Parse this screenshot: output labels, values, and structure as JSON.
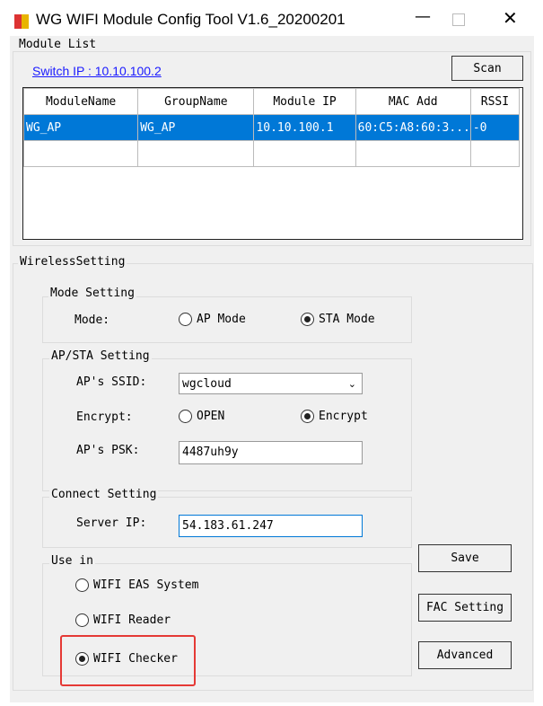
{
  "window": {
    "title": "WG WIFI Module Config Tool V1.6_20200201"
  },
  "module_list": {
    "label": "Module List",
    "switch_ip": "Switch IP : 10.10.100.2",
    "scan": "Scan",
    "columns": [
      "ModuleName",
      "GroupName",
      "Module IP",
      "MAC Add",
      "RSSI"
    ],
    "rows": [
      [
        "WG_AP",
        "WG_AP",
        "10.10.100.1",
        "60:C5:A8:60:3...",
        "-0"
      ]
    ]
  },
  "wireless": {
    "label": "WirelessSetting",
    "mode": {
      "label": "Mode Setting",
      "field": "Mode:",
      "ap": "AP Mode",
      "sta": "STA Mode",
      "selected": "STA Mode"
    },
    "apsta": {
      "label": "AP/STA Setting",
      "ssid_label": "AP's SSID:",
      "ssid": "wgcloud",
      "encrypt_label": "Encrypt:",
      "open": "OPEN",
      "encrypt": "Encrypt",
      "selected": "Encrypt",
      "psk_label": "AP's PSK:",
      "psk": "4487uh9y"
    },
    "connect": {
      "label": "Connect Setting",
      "server_label": "Server IP:",
      "server_ip": "54.183.61.247"
    },
    "use_in": {
      "label": "Use in",
      "options": [
        "WIFI EAS System",
        "WIFI Reader",
        "WIFI Checker"
      ],
      "selected": "WIFI Checker"
    },
    "buttons": {
      "save": "Save",
      "fac": "FAC Setting",
      "advanced": "Advanced"
    }
  },
  "colors": {
    "selection": "#0078d7",
    "highlight": "#e53935",
    "link": "#1a1aff"
  }
}
